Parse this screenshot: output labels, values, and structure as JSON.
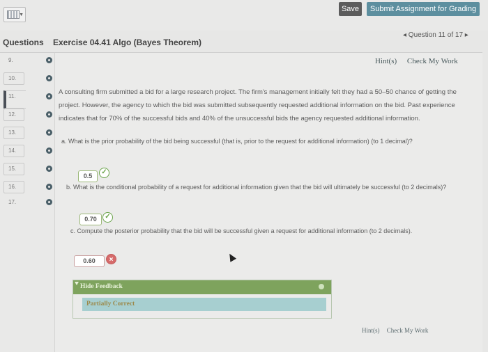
{
  "toolbar": {
    "save_label": "Save",
    "submit_label": "Submit Assignment for Grading"
  },
  "header": {
    "questions_label": "Questions",
    "exercise_title": "Exercise 04.41 Algo (Bayes Theorem)",
    "question_nav": "◂ Question 11 of 17 ▸"
  },
  "sidebar": {
    "items": [
      {
        "num": "9."
      },
      {
        "num": "10."
      },
      {
        "num": "11."
      },
      {
        "num": "12."
      },
      {
        "num": "13."
      },
      {
        "num": "14."
      },
      {
        "num": "15."
      },
      {
        "num": "16."
      },
      {
        "num": "17."
      }
    ]
  },
  "links": {
    "hints": "Hint(s)",
    "check": "Check My Work"
  },
  "problem": {
    "text": "A consulting firm submitted a bid for a large research project. The firm's management initially felt they had a 50–50 chance of getting the project. However, the agency to which the bid was submitted subsequently requested additional information on the bid. Past experience indicates that for 70% of the successful bids and 40% of the unsuccessful bids the agency requested additional information."
  },
  "parts": {
    "a": {
      "question": "a. What is the prior probability of the bid being successful (that is, prior to the request for additional information) (to 1 decimal)?",
      "answer": "0.5"
    },
    "b": {
      "question": "b. What is the conditional probability of a request for additional information given that the bid will ultimately be successful (to 2 decimals)?",
      "answer": "0.70"
    },
    "c": {
      "question": "c. Compute the posterior probability that the bid will be successful given a request for additional information (to 2 decimals).",
      "answer": "0.60"
    }
  },
  "feedback": {
    "toggle_label": "Hide Feedback",
    "status": "Partially Correct"
  },
  "colors": {
    "submit": "#5d8f9f",
    "correct": "#6aa34a",
    "incorrect": "#d66b6b",
    "feedback_bar": "#7ea35d",
    "feedback_status": "#a7cfd0"
  }
}
